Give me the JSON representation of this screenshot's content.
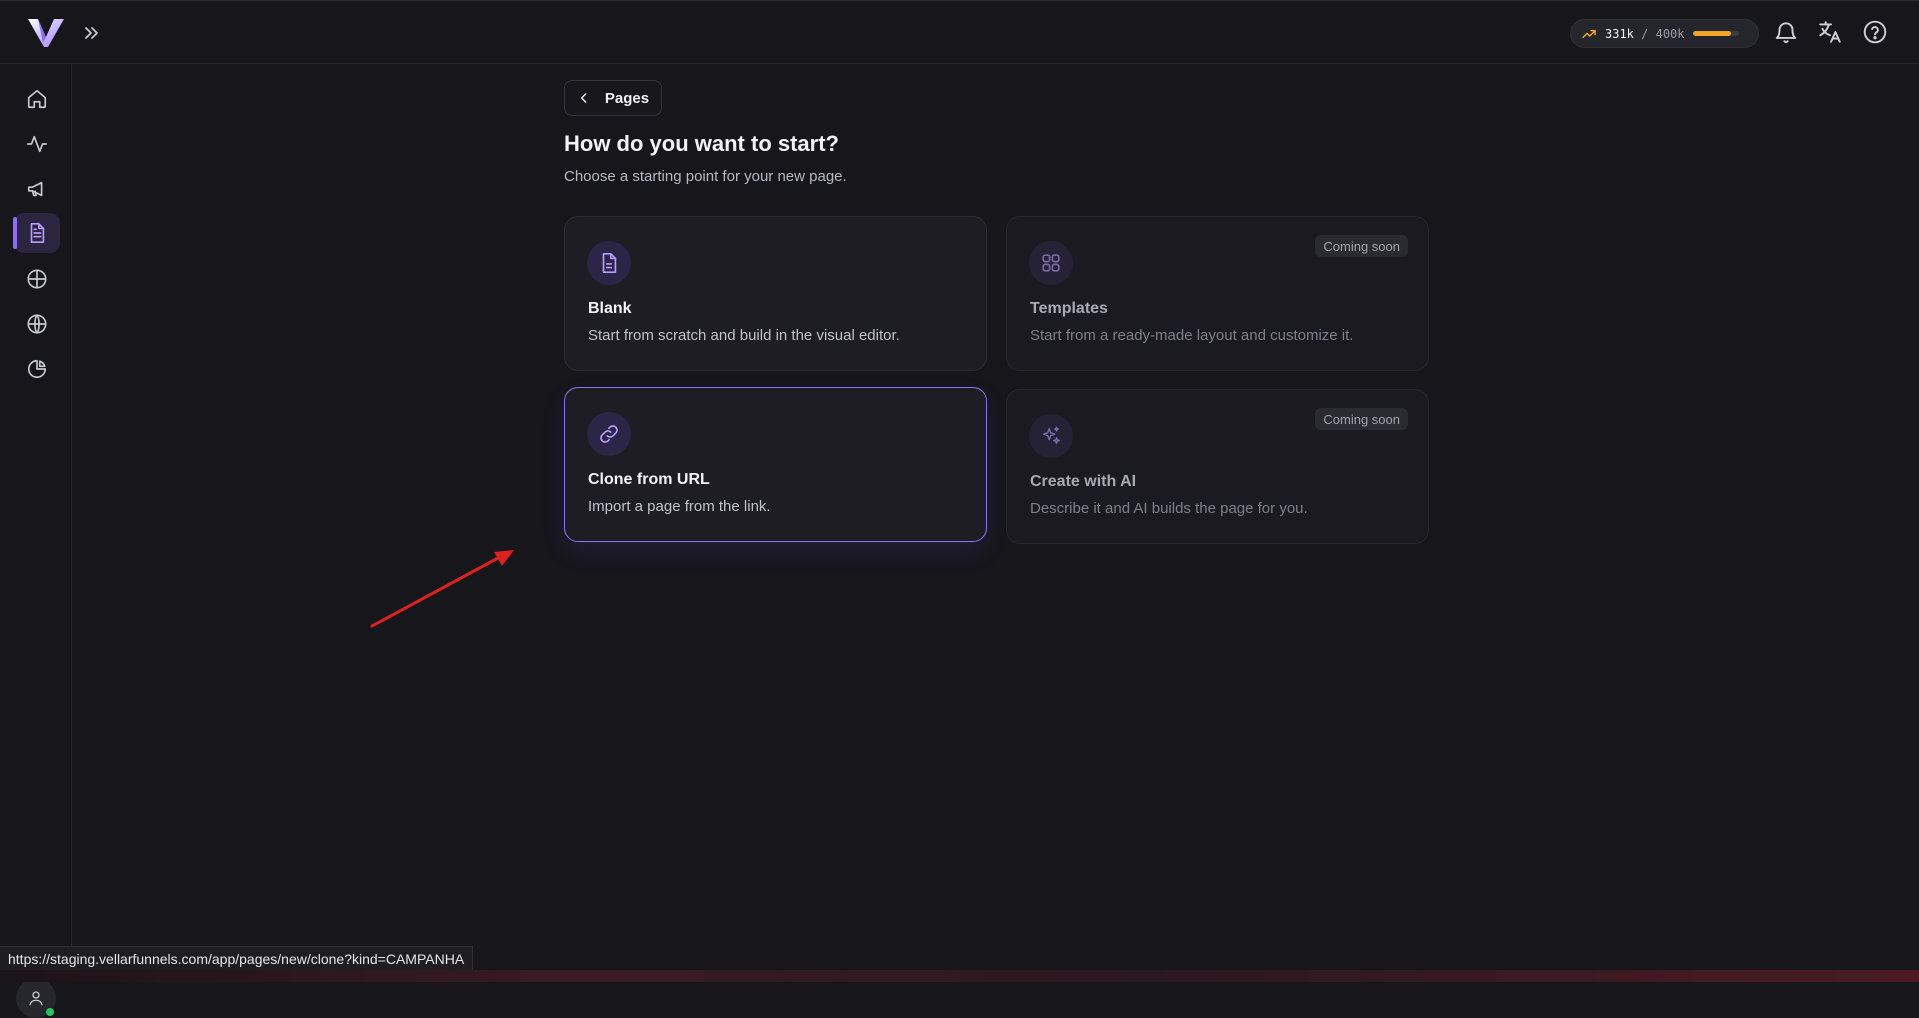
{
  "topbar": {
    "usage": {
      "used": "331k",
      "separator": "/",
      "total": "400k",
      "fraction": 0.83,
      "accent": "#f5a524"
    },
    "icons": [
      "trending-up-icon",
      "bell-icon",
      "translate-icon",
      "help-icon"
    ]
  },
  "sidebar": {
    "items": [
      {
        "icon": "home-icon",
        "active": false
      },
      {
        "icon": "activity-icon",
        "active": false
      },
      {
        "icon": "megaphone-icon",
        "active": false
      },
      {
        "icon": "file-text-icon",
        "active": true
      },
      {
        "icon": "crosshair-icon",
        "active": false
      },
      {
        "icon": "globe-icon",
        "active": false
      },
      {
        "icon": "pie-chart-icon",
        "active": false
      }
    ],
    "accent": "#8d6bff"
  },
  "main": {
    "back_label": "Pages",
    "title": "How do you want to start?",
    "subtitle": "Choose a starting point for your new page.",
    "options": [
      {
        "id": "blank",
        "icon": "file-icon",
        "title": "Blank",
        "description": "Start from scratch and build in the visual editor.",
        "badge": "",
        "enabled": true,
        "selected": false
      },
      {
        "id": "templates",
        "icon": "grid-icon",
        "title": "Templates",
        "description": "Start from a ready-made layout and customize it.",
        "badge": "Coming soon",
        "enabled": false,
        "selected": false
      },
      {
        "id": "clone",
        "icon": "link-icon",
        "title": "Clone from URL",
        "description": "Import a page from the link.",
        "badge": "",
        "enabled": true,
        "selected": true
      },
      {
        "id": "ai",
        "icon": "sparkles-icon",
        "title": "Create with AI",
        "description": "Describe it and AI builds the page for you.",
        "badge": "Coming soon",
        "enabled": false,
        "selected": false
      }
    ]
  },
  "status_bar": {
    "url": "https://staging.vellarfunnels.com/app/pages/new/clone?kind=CAMPANHA"
  },
  "annotation": {
    "arrow_color": "#e02020"
  }
}
